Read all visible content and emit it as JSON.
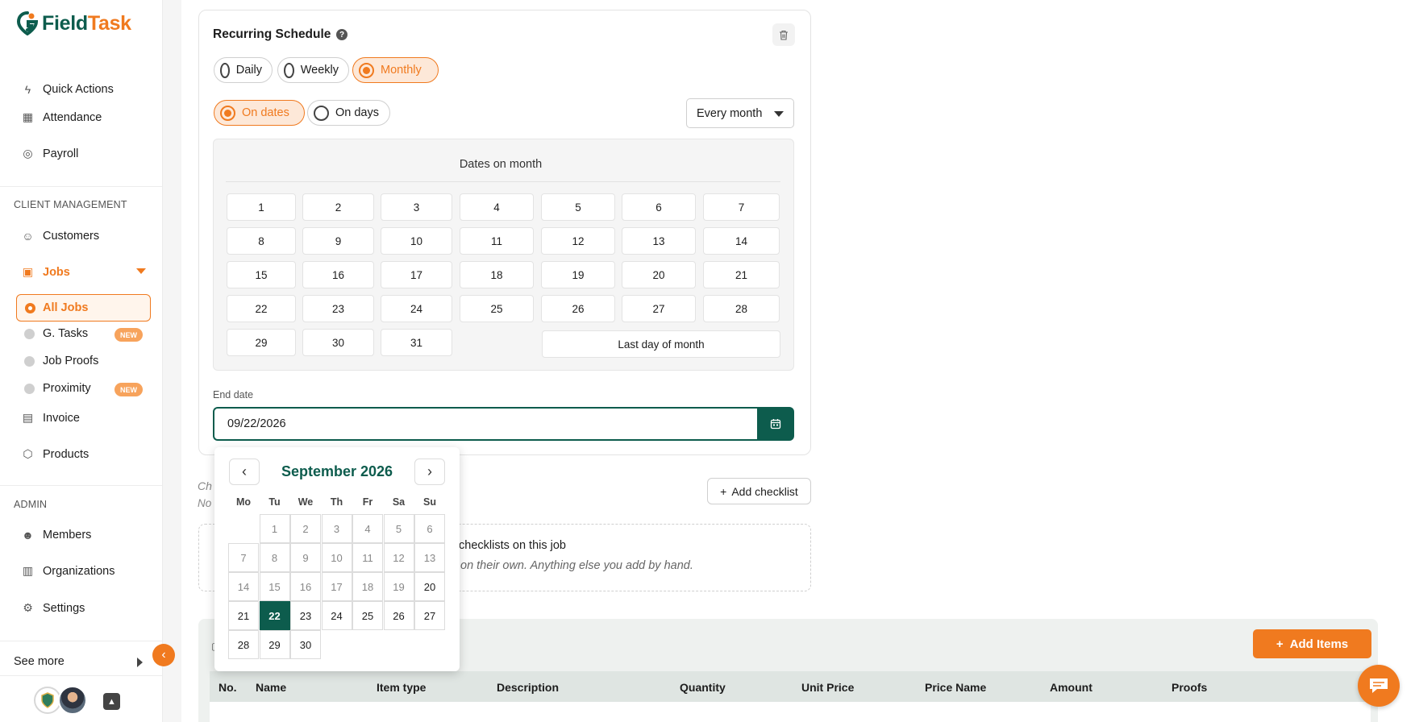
{
  "brand": {
    "name_part1": "Field",
    "name_part2": "Task"
  },
  "sidebar": {
    "top_items": [
      {
        "label": "Quick Actions",
        "icon": "lightning-icon"
      },
      {
        "label": "Attendance",
        "icon": "calendar-grid-icon"
      },
      {
        "label": "Payroll",
        "icon": "money-icon"
      }
    ],
    "client_section": "CLIENT MANAGEMENT",
    "customers": "Customers",
    "jobs": "Jobs",
    "all_jobs": "All Jobs",
    "g_tasks": "G. Tasks",
    "job_proofs": "Job Proofs",
    "proximity": "Proximity",
    "new_badge": "NEW",
    "invoice": "Invoice",
    "products": "Products",
    "admin_section": "ADMIN",
    "members": "Members",
    "organizations": "Organizations",
    "settings": "Settings",
    "see_more": "See more"
  },
  "schedule": {
    "title": "Recurring Schedule",
    "frequency_options": [
      "Daily",
      "Weekly",
      "Monthly"
    ],
    "frequency_selected": "Monthly",
    "mode_options": [
      "On dates",
      "On days"
    ],
    "mode_selected": "On dates",
    "interval": "Every month",
    "dates_title": "Dates on month",
    "dates": [
      "1",
      "2",
      "3",
      "4",
      "5",
      "6",
      "7",
      "8",
      "9",
      "10",
      "11",
      "12",
      "13",
      "14",
      "15",
      "16",
      "17",
      "18",
      "19",
      "20",
      "21",
      "22",
      "23",
      "24",
      "25",
      "26",
      "27",
      "28",
      "29",
      "30",
      "31"
    ],
    "last_day_label": "Last day of month",
    "end_date_label": "End date",
    "end_date_value": "09/22/2026"
  },
  "datepicker": {
    "month_label": "September 2026",
    "weekdays": [
      "Mo",
      "Tu",
      "We",
      "Th",
      "Fr",
      "Sa",
      "Su"
    ],
    "days": [
      "1",
      "2",
      "3",
      "4",
      "5",
      "6",
      "7",
      "8",
      "9",
      "10",
      "11",
      "12",
      "13",
      "14",
      "15",
      "16",
      "17",
      "18",
      "19",
      "20",
      "21",
      "22",
      "23",
      "24",
      "25",
      "26",
      "27",
      "28",
      "29",
      "30"
    ],
    "selected_day": "22",
    "prev_label": "‹",
    "next_label": "›"
  },
  "checklist": {
    "title_partial": "Ch",
    "sub_partial": "No",
    "add_label": "Add checklist",
    "empty_title_partial": "checklists on this job",
    "empty_sub_partial": "on their own. Anything else you add by hand."
  },
  "items": {
    "add_label": "Add Items",
    "columns": [
      "No.",
      "Name",
      "Item type",
      "Description",
      "Quantity",
      "Unit Price",
      "Price Name",
      "Amount",
      "Proofs"
    ]
  },
  "colors": {
    "brand_green": "#0d5c4d",
    "brand_orange": "#f07a1f"
  }
}
